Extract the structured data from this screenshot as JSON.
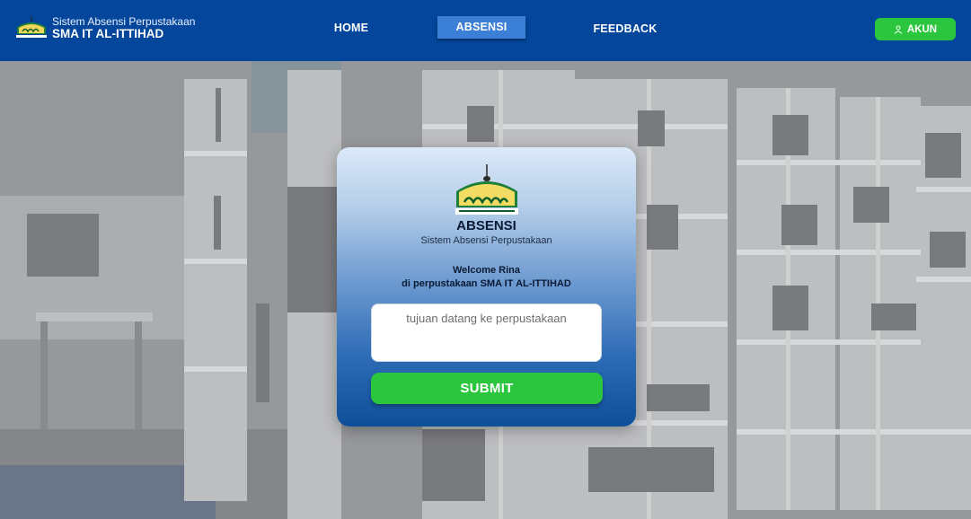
{
  "navbar": {
    "brand_subtitle": "Sistem Absensi Perpustakaan",
    "brand_title": "SMA IT AL-ITTIHAD",
    "links": {
      "home": "HOME",
      "absensi": "ABSENSI",
      "feedback": "FEEDBACK"
    },
    "active_link": "ABSENSI",
    "account_label": "AKUN",
    "account_icon": "user-icon"
  },
  "card": {
    "title": "ABSENSI",
    "subtitle": "Sistem Absensi Perpustakaan",
    "welcome_line1": "Welcome Rina",
    "welcome_line2": "di perpustakaan SMA IT AL-ITTIHAD",
    "purpose_input": {
      "value": "",
      "placeholder": "tujuan datang ke perpustakaan"
    },
    "submit_label": "SUBMIT"
  },
  "colors": {
    "navbar": "#03469b",
    "nav_active": "#3c7fd6",
    "accent_green": "#2bc63d",
    "card_top": "#dbe9f8",
    "card_bottom": "#0e4f9a"
  }
}
